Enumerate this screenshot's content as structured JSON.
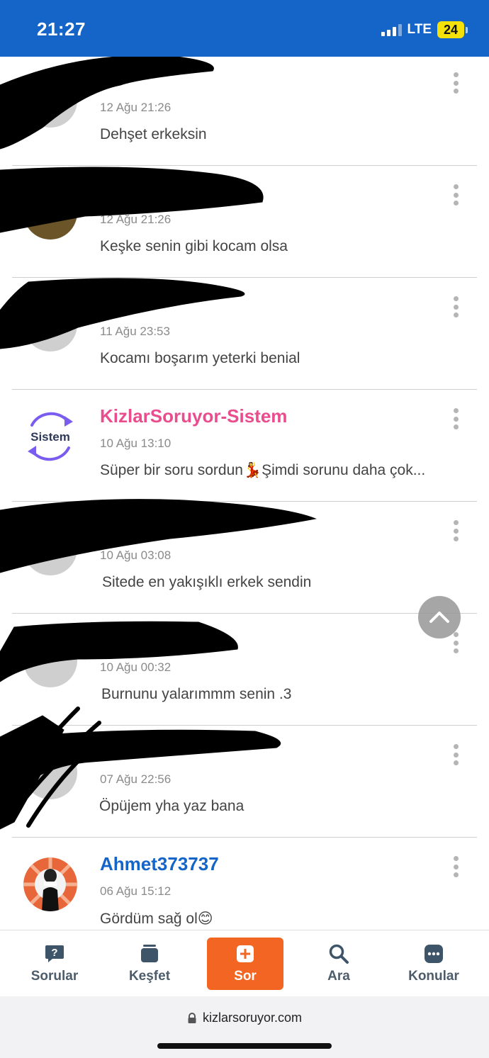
{
  "status_bar": {
    "time": "21:27",
    "network": "LTE",
    "battery": "24"
  },
  "comments": [
    {
      "username": "",
      "timestamp": "12 Ağu 21:26",
      "text": "Dehşet erkeksin",
      "username_color": "#333333"
    },
    {
      "username": "",
      "timestamp": "12 Ağu 21:26",
      "text": "Keşke senin gibi kocam olsa",
      "username_color": "#333333"
    },
    {
      "username": "",
      "timestamp": "11 Ağu 23:53",
      "text": "Kocamı boşarım yeterki benial",
      "username_color": "#333333"
    },
    {
      "username": "KizlarSoruyor-Sistem",
      "timestamp": "10 Ağu 13:10",
      "text": "Süper bir soru sordun💃Şimdi sorunu daha çok...",
      "username_color": "#e94d8e",
      "avatar_label": "Sistem"
    },
    {
      "username": "",
      "timestamp": "10 Ağu 03:08",
      "text": "Sitede en yakışıklı erkek sendin",
      "username_color": "#e94d8e"
    },
    {
      "username": "",
      "timestamp": "10 Ağu 00:32",
      "text": "Burnunu yalarımmm senin .3",
      "username_color": "#e94d8e"
    },
    {
      "username": "",
      "timestamp": "07 Ağu 22:56",
      "text": "Öpüjem yha yaz bana",
      "username_color": "#333333"
    },
    {
      "username": "Ahmet373737",
      "timestamp": "06 Ağu 15:12",
      "text": "Gördüm sağ ol😊",
      "username_color": "#1565c8"
    }
  ],
  "bottom_nav": [
    {
      "label": "Sorular",
      "icon": "question-bubble-icon",
      "active": false
    },
    {
      "label": "Keşfet",
      "icon": "cards-icon",
      "active": false
    },
    {
      "label": "Sor",
      "icon": "plus-icon",
      "active": true
    },
    {
      "label": "Ara",
      "icon": "search-icon",
      "active": false
    },
    {
      "label": "Konular",
      "icon": "chat-dots-icon",
      "active": false
    }
  ],
  "browser": {
    "url": "kizlarsoruyor.com"
  },
  "colors": {
    "brand_blue": "#1565c8",
    "accent_orange": "#f26522",
    "pink": "#e94d8e"
  }
}
